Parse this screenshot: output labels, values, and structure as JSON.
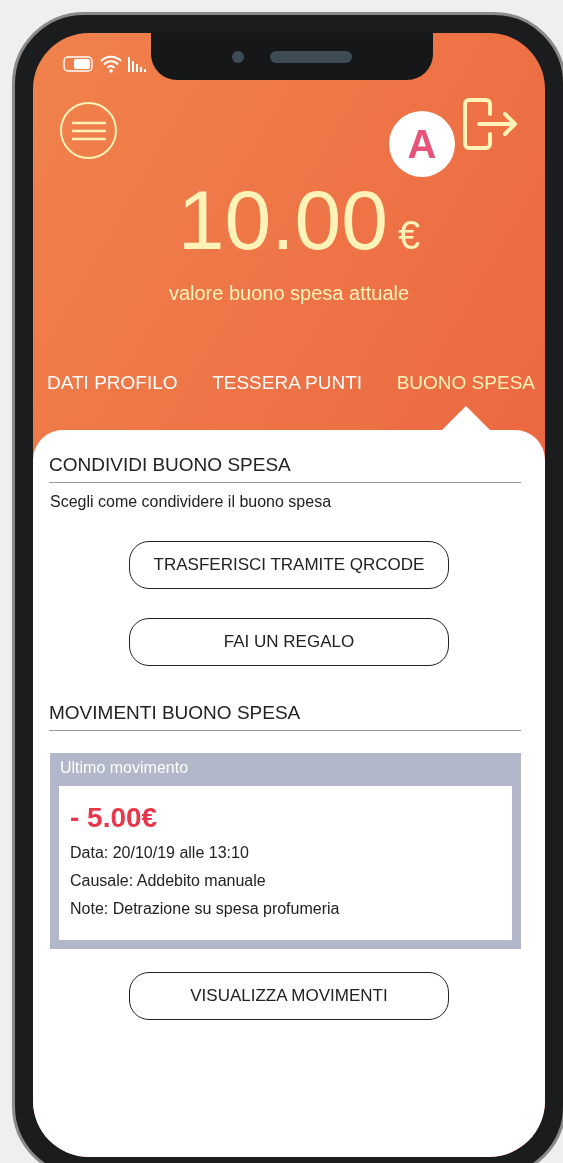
{
  "header": {
    "avatar_initial": "A",
    "amount": "10.00",
    "currency": "€",
    "caption": "valore buono spesa attuale"
  },
  "tabs": [
    {
      "label": "DATI PROFILO",
      "selected": false
    },
    {
      "label": "TESSERA PUNTI",
      "selected": false
    },
    {
      "label": "BUONO SPESA",
      "selected": true
    }
  ],
  "share_section": {
    "title": "CONDIVIDI BUONO SPESA",
    "description": "Scegli come condividere il buono spesa",
    "buttons": [
      "TRASFERISCI TRAMITE QRCODE",
      "FAI UN REGALO"
    ]
  },
  "movements_section": {
    "title": "MOVIMENTI BUONO SPESA",
    "last_movement": {
      "label": "Ultimo movimento",
      "amount": "- 5.00€",
      "date": "Data: 20/10/19 alle 13:10",
      "reason": "Causale: Addebito manuale",
      "note": "Note: Detrazione su spesa profumeria"
    },
    "button": "VISUALIZZA MOVIMENTI"
  }
}
